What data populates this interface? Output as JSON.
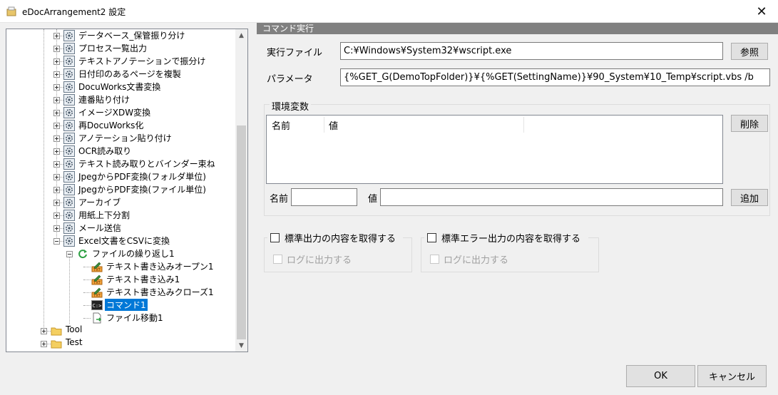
{
  "window": {
    "title": "eDocArrangement2 設定",
    "close_glyph": "✕"
  },
  "tree": {
    "items": [
      {
        "label": "データベース_保管振り分け"
      },
      {
        "label": "プロセス一覧出力"
      },
      {
        "label": "テキストアノテーションで振分け"
      },
      {
        "label": "日付印のあるページを複製"
      },
      {
        "label": "DocuWorks文書変換"
      },
      {
        "label": "連番貼り付け"
      },
      {
        "label": "イメージXDW変換"
      },
      {
        "label": "再DocuWorks化"
      },
      {
        "label": "アノテーション貼り付け"
      },
      {
        "label": "OCR読み取り"
      },
      {
        "label": "テキスト読み取りとバインダー束ね"
      },
      {
        "label": "JpegからPDF変換(フォルダ単位)"
      },
      {
        "label": "JpegからPDF変換(ファイル単位)"
      },
      {
        "label": "アーカイブ"
      },
      {
        "label": "用紙上下分割"
      },
      {
        "label": "メール送信"
      },
      {
        "label": "Excel文書をCSVに変換"
      }
    ],
    "loop": {
      "label": "ファイルの繰り返し1"
    },
    "children": [
      {
        "label": "テキスト書き込みオープン1",
        "icon": "text-write-icon"
      },
      {
        "label": "テキスト書き込み1",
        "icon": "text-write-icon"
      },
      {
        "label": "テキスト書き込みクローズ1",
        "icon": "text-write-icon"
      },
      {
        "label": "コマンド1",
        "icon": "command-icon",
        "selected": true
      },
      {
        "label": "ファイル移動1",
        "icon": "file-move-icon"
      }
    ],
    "folders": [
      {
        "label": "Tool"
      },
      {
        "label": "Test"
      }
    ]
  },
  "command": {
    "section_title": "コマンド実行",
    "exec_file_label": "実行ファイル",
    "exec_file_value": "C:¥Windows¥System32¥wscript.exe",
    "browse_label": "参照",
    "param_label": "パラメータ",
    "param_value": "{%GET_G(DemoTopFolder)}¥{%GET(SettingName)}¥90_System¥10_Temp¥script.vbs /b"
  },
  "env": {
    "group_label": "環境変数",
    "col_name": "名前",
    "col_value": "値",
    "delete_label": "削除",
    "name_label": "名前",
    "name_value": "",
    "value_label": "値",
    "value_value": "",
    "add_label": "追加"
  },
  "stdout": {
    "label": "標準出力の内容を取得する",
    "log_label": "ログに出力する",
    "checked": false
  },
  "stderr": {
    "label": "標準エラー出力の内容を取得する",
    "log_label": "ログに出力する",
    "checked": false
  },
  "footer": {
    "ok_label": "OK",
    "cancel_label": "キャンセル"
  },
  "colors": {
    "selection": "#0078d7",
    "section_header": "#808080",
    "loop_icon": "#2ea043"
  }
}
